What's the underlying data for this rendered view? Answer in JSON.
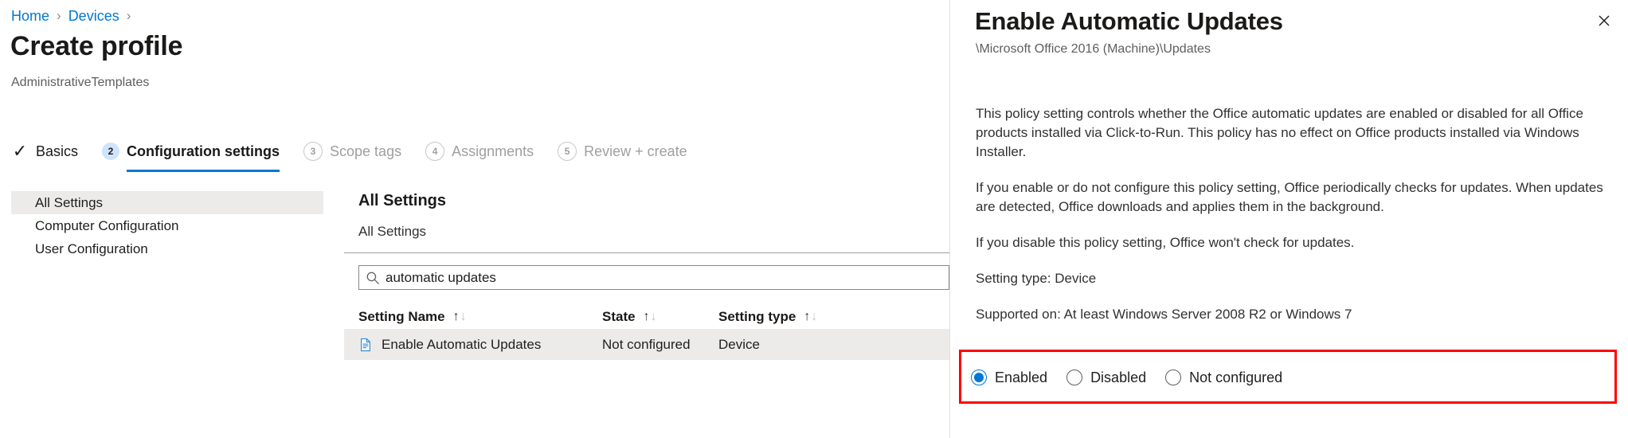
{
  "breadcrumb": {
    "items": [
      "Home",
      "Devices"
    ],
    "separator": "›"
  },
  "page": {
    "title": "Create profile",
    "subtitle": "AdministrativeTemplates"
  },
  "wizard": {
    "steps": [
      {
        "marker": "✓",
        "label": "Basics",
        "state": "done"
      },
      {
        "marker": "2",
        "label": "Configuration settings",
        "state": "active"
      },
      {
        "marker": "3",
        "label": "Scope tags",
        "state": "todo"
      },
      {
        "marker": "4",
        "label": "Assignments",
        "state": "todo"
      },
      {
        "marker": "5",
        "label": "Review + create",
        "state": "todo"
      }
    ]
  },
  "nav": {
    "items": [
      {
        "label": "All Settings",
        "selected": true
      },
      {
        "label": "Computer Configuration",
        "selected": false
      },
      {
        "label": "User Configuration",
        "selected": false
      }
    ]
  },
  "settings": {
    "heading": "All Settings",
    "path": "All Settings",
    "search": {
      "value": "automatic updates",
      "placeholder": "Search",
      "icon": "search-icon"
    },
    "table": {
      "columns": [
        {
          "label": "Setting Name",
          "sort_asc": "↑",
          "sort_desc": "↓"
        },
        {
          "label": "State",
          "sort_asc": "↑",
          "sort_desc": "↓"
        },
        {
          "label": "Setting type",
          "sort_asc": "↑",
          "sort_desc": "↓"
        }
      ],
      "rows": [
        {
          "icon": "policy-document-icon",
          "name": "Enable Automatic Updates",
          "state": "Not configured",
          "type": "Device",
          "selected": true
        }
      ]
    }
  },
  "panel": {
    "title": "Enable Automatic Updates",
    "subtitle": "\\Microsoft Office 2016 (Machine)\\Updates",
    "close_icon": "close-icon",
    "paragraphs": [
      "This policy setting controls whether the Office automatic updates are enabled or disabled for all Office products installed via Click-to-Run. This policy has no effect on Office products installed via Windows Installer.",
      "If you enable or do not configure this policy setting, Office periodically checks for updates. When updates are detected, Office downloads and applies them in the background.",
      "If you disable this policy setting, Office won't check for updates.",
      "Setting type: Device",
      "Supported on: At least Windows Server 2008 R2 or Windows 7"
    ],
    "radio_group": {
      "name": "policy-state",
      "highlight_color": "#ff0000",
      "accent_color": "#0078d4",
      "options": [
        {
          "label": "Enabled",
          "checked": true
        },
        {
          "label": "Disabled",
          "checked": false
        },
        {
          "label": "Not configured",
          "checked": false
        }
      ]
    }
  }
}
